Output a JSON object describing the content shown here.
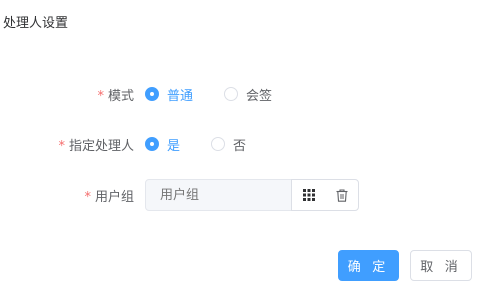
{
  "dialog": {
    "title": "处理人设置"
  },
  "form": {
    "mode": {
      "label": "模式",
      "required_mark": "*",
      "options": [
        {
          "label": "普通",
          "checked": true
        },
        {
          "label": "会签",
          "checked": false
        }
      ]
    },
    "assign_handler": {
      "label": "指定处理人",
      "required_mark": "*",
      "options": [
        {
          "label": "是",
          "checked": true
        },
        {
          "label": "否",
          "checked": false
        }
      ]
    },
    "user_group": {
      "label": "用户组",
      "required_mark": "*",
      "placeholder": "用户组",
      "value": "",
      "actions": [
        {
          "icon": "grid-icon"
        },
        {
          "icon": "trash-icon"
        }
      ]
    }
  },
  "footer": {
    "confirm_label": "确 定",
    "cancel_label": "取 消"
  },
  "colors": {
    "primary": "#409eff",
    "required": "#f56c6c",
    "text": "#606266",
    "placeholder": "#c0c4cc",
    "disabled_bg": "#f5f7fa"
  }
}
